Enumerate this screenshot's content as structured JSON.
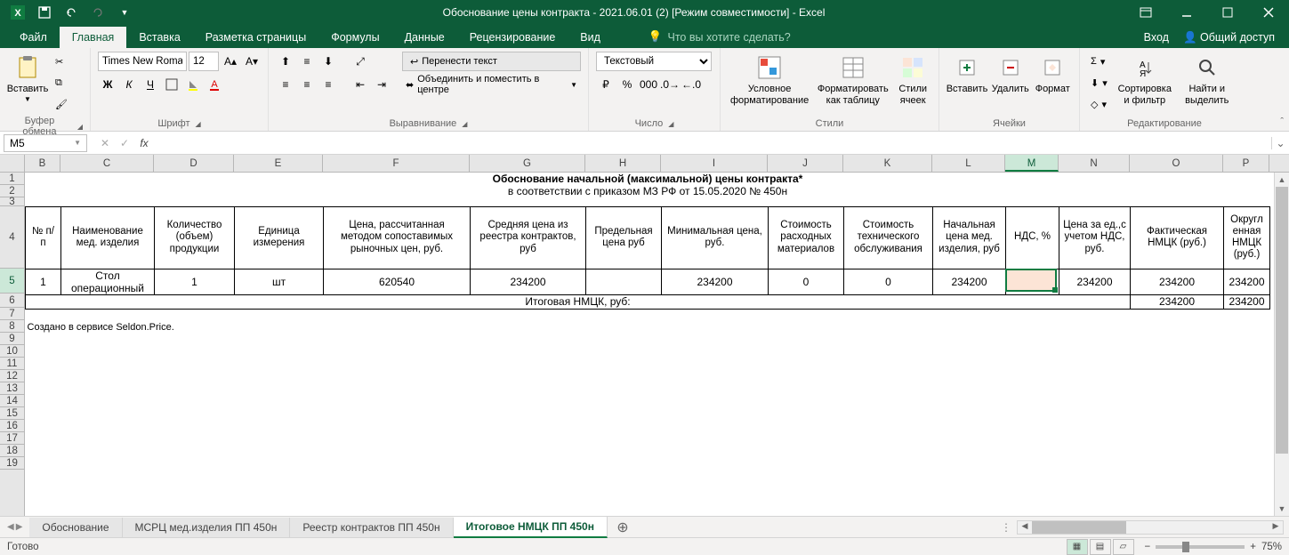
{
  "app": {
    "title": "Обоснование цены контракта - 2021.06.01 (2)  [Режим совместимости] - Excel"
  },
  "tabs": {
    "file": "Файл",
    "items": [
      "Главная",
      "Вставка",
      "Разметка страницы",
      "Формулы",
      "Данные",
      "Рецензирование",
      "Вид"
    ],
    "active_index": 0,
    "tell_me": "Что вы хотите сделать?",
    "login": "Вход",
    "share": "Общий доступ"
  },
  "ribbon": {
    "clipboard": {
      "paste": "Вставить",
      "label": "Буфер обмена"
    },
    "font": {
      "name": "Times New Roma",
      "size": "12",
      "label": "Шрифт",
      "bold": "Ж",
      "italic": "К",
      "underline": "Ч"
    },
    "alignment": {
      "wrap": "Перенести текст",
      "merge": "Объединить и поместить в центре",
      "label": "Выравнивание"
    },
    "number": {
      "format": "Текстовый",
      "label": "Число"
    },
    "styles": {
      "cond": "Условное форматирование",
      "astable": "Форматировать как таблицу",
      "cellstyles": "Стили ячеек",
      "label": "Стили"
    },
    "cells": {
      "insert": "Вставить",
      "delete": "Удалить",
      "format": "Формат",
      "label": "Ячейки"
    },
    "editing": {
      "sort": "Сортировка и фильтр",
      "find": "Найти и выделить",
      "label": "Редактирование"
    }
  },
  "formula_bar": {
    "cell_ref": "M5",
    "formula": ""
  },
  "columns": [
    {
      "l": "B",
      "w": 40
    },
    {
      "l": "C",
      "w": 105
    },
    {
      "l": "D",
      "w": 90
    },
    {
      "l": "E",
      "w": 100
    },
    {
      "l": "F",
      "w": 165
    },
    {
      "l": "G",
      "w": 130
    },
    {
      "l": "H",
      "w": 85
    },
    {
      "l": "I",
      "w": 120
    },
    {
      "l": "J",
      "w": 85
    },
    {
      "l": "K",
      "w": 100
    },
    {
      "l": "L",
      "w": 82
    },
    {
      "l": "M",
      "w": 60
    },
    {
      "l": "N",
      "w": 80
    },
    {
      "l": "O",
      "w": 105
    },
    {
      "l": "P",
      "w": 52
    }
  ],
  "selected_col": "M",
  "selected_row": 5,
  "sheet": {
    "title": "Обоснование начальной (максимальной) цены контракта*",
    "subtitle": "в соответствии с приказом МЗ РФ от 15.05.2020 № 450н",
    "headers": {
      "b": "№ п/п",
      "c": "Наименование мед. изделия",
      "d": "Количество (объем) продукции",
      "e": "Единица измерения",
      "f": "Цена, рассчитанная методом сопоставимых рыночных цен, руб.",
      "g": "Средняя цена из реестра контрактов, руб",
      "h": "Предельная цена руб",
      "i": "Минимальная цена, руб.",
      "j": "Стоимость расходных материалов",
      "k": "Стоимость технического обслуживания",
      "l": "Начальная цена мед. изделия, руб",
      "m": "НДС, %",
      "n": "Цена за ед.,с учетом НДС, руб.",
      "o": "Фактическая НМЦК (руб.)",
      "p": "Округл енная НМЦК (руб.)"
    },
    "row": {
      "b": "1",
      "c": "Стол операционный",
      "d": "1",
      "e": "шт",
      "f": "620540",
      "g": "234200",
      "h": "",
      "i": "234200",
      "j": "0",
      "k": "0",
      "l": "234200",
      "m": "",
      "n": "234200",
      "o": "234200",
      "p": "234200"
    },
    "total_label": "Итоговая НМЦК, руб:",
    "total_o": "234200",
    "total_p": "234200",
    "footer": "Создано в сервисе Seldon.Price."
  },
  "sheet_tabs": {
    "items": [
      "Обоснование",
      "МСРЦ мед.изделия ПП 450н",
      "Реестр контрактов ПП 450н",
      "Итоговое НМЦК ПП 450н"
    ],
    "active_index": 3
  },
  "statusbar": {
    "ready": "Готово",
    "zoom": "75%"
  }
}
